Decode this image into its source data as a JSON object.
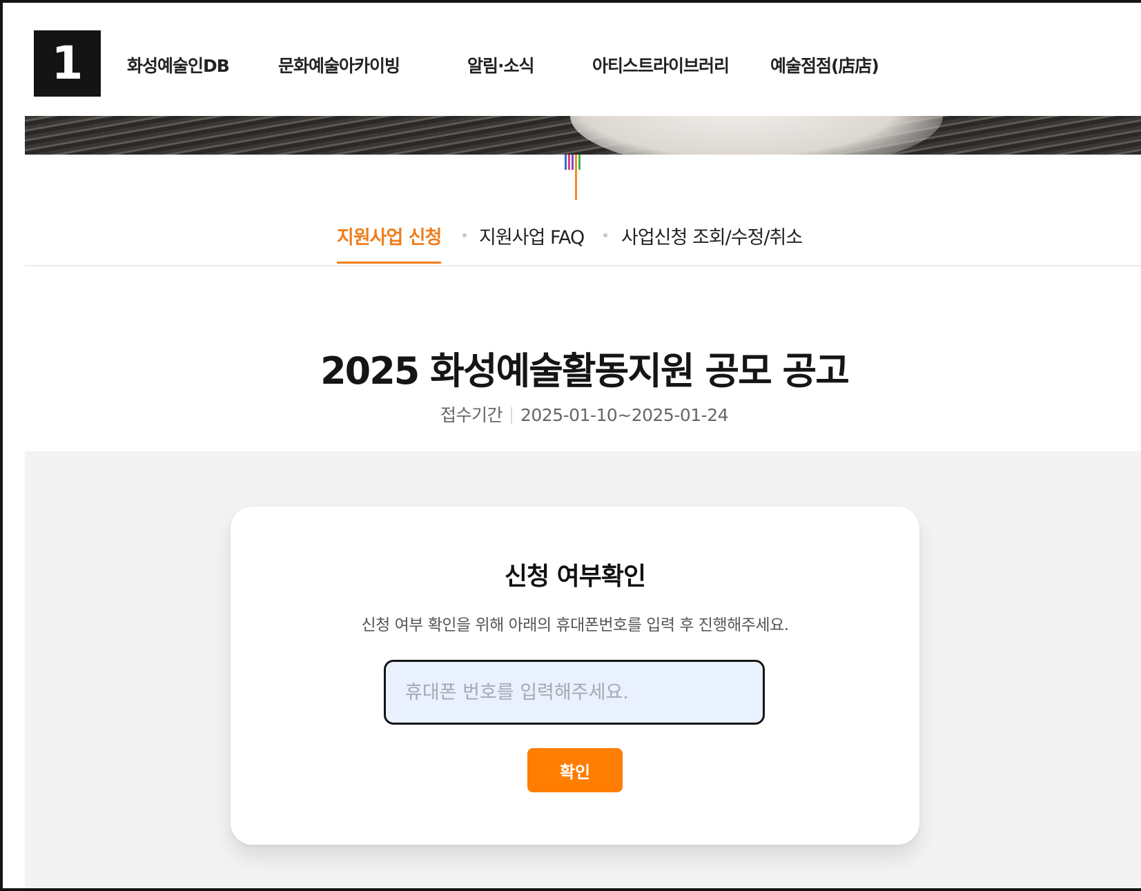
{
  "badge": {
    "number": "1"
  },
  "gnb": {
    "items": [
      {
        "label": "화성예술인DB"
      },
      {
        "label": "문화예술아카이빙"
      },
      {
        "label": "알림·소식"
      },
      {
        "label": "아티스트라이브러리"
      },
      {
        "label": "예술점점(店店)"
      }
    ]
  },
  "subtabs": {
    "items": [
      {
        "label": "지원사업 신청",
        "active": true
      },
      {
        "label": "지원사업 FAQ",
        "active": false
      },
      {
        "label": "사업신청 조회/수정/취소",
        "active": false
      }
    ]
  },
  "notice": {
    "title": "2025 화성예술활동지원 공모 공고",
    "period_label": "접수기간",
    "period_value": "2025-01-10~2025-01-24"
  },
  "check_card": {
    "title": "신청 여부확인",
    "description": "신청 여부 확인을 위해 아래의 휴대폰번호를 입력 후 진행해주세요.",
    "phone_input": {
      "value": "",
      "placeholder": "휴대폰 번호를 입력해주세요."
    },
    "confirm_label": "확인"
  },
  "colors": {
    "accent": "#f07d1b",
    "button": "#ff7d00",
    "input_bg": "#e9f0fe",
    "deco_lines": [
      "#2f6fd6",
      "#e23b7a",
      "#7b4bd1",
      "#f28c1e",
      "#3fb34f"
    ]
  }
}
